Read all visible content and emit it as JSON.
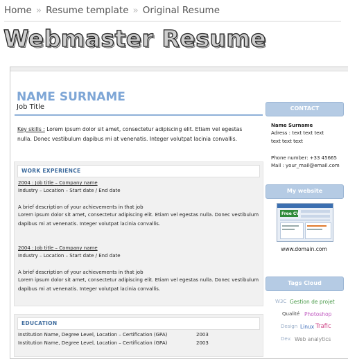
{
  "breadcrumb": {
    "items": [
      "Home",
      "Resume template",
      "Original Resume"
    ],
    "separator": "»"
  },
  "site_title": "Webmaster Resume",
  "resume": {
    "name": "NAME SURNAME",
    "job_title": "Job Title",
    "skills_label": "Key skills :",
    "skills_text_line1": " Lorem ipsum dolor sit amet, consectetur adipiscing elit. Etiam vel egestas",
    "skills_text_line2": "nulla. Donec vestibulum dapibus mi at venenatis. Integer volutpat lacinia convallis.",
    "work_experience": {
      "heading": "WORK EXPERIENCE",
      "jobs": [
        {
          "title_line": "2004 : Job title – Company name",
          "meta_line": "Industry – Location – Start date / End date",
          "desc_line1": "A brief description of your achievements in that job",
          "desc_line2": "Lorem ipsum dolor sit amet, consectetur adipiscing elit. Etiam vel egestas nulla. Donec vestibulum",
          "desc_line3": "dapibus mi at venenatis. Integer volutpat lacinia convallis."
        },
        {
          "title_line": "2004 : Job title – Company name",
          "meta_line": "Industry – Location – Start date / End date",
          "desc_line1": "A brief description of your achievements in that job",
          "desc_line2": "Lorem ipsum dolor sit amet, consectetur adipiscing elit. Etiam vel egestas nulla. Donec vestibulum",
          "desc_line3": "dapibus mi at venenatis. Integer volutpat lacinia convallis."
        }
      ]
    },
    "education": {
      "heading": "EDUCATION",
      "rows": [
        {
          "text": "Institution Name, Degree Level, Location – Certification (GPA)",
          "year": "2003"
        },
        {
          "text": "Institution Name, Degree Level, Location – Certification (GPA)",
          "year": "2003"
        }
      ]
    }
  },
  "sidebar": {
    "contact": {
      "heading": "CONTACT",
      "name": "Name Surname",
      "address_line1": "Adress : text text text",
      "address_line2": "text text text",
      "phone": "Phone number: +33 45665",
      "mail": "Mail : your_mail@email.com"
    },
    "website": {
      "heading": "My website",
      "thumbnail_text": "Free CV",
      "domain": "www.domain.com"
    },
    "tags": {
      "heading": "Tags Cloud",
      "items": [
        {
          "text": "W3C",
          "color": "#9aaec8"
        },
        {
          "text": "Gestion de projet",
          "color": "#4a9a4a"
        },
        {
          "text": "Qualité",
          "color": "#444444"
        },
        {
          "text": "Photoshop",
          "color": "#c05ac0"
        },
        {
          "text": "Design",
          "color": "#9aaec8"
        },
        {
          "text": "Linux",
          "color": "#3a6ab8"
        },
        {
          "text": "Trafic",
          "color": "#d04a8a"
        },
        {
          "text": "Dev.",
          "color": "#9aaec8"
        },
        {
          "text": "Web analytics",
          "color": "#888888"
        }
      ]
    }
  },
  "colors": {
    "accent_blue": "#7ea6d6",
    "sidebar_head": "#b5cbe4",
    "panel_grey": "#f1f1f1"
  }
}
